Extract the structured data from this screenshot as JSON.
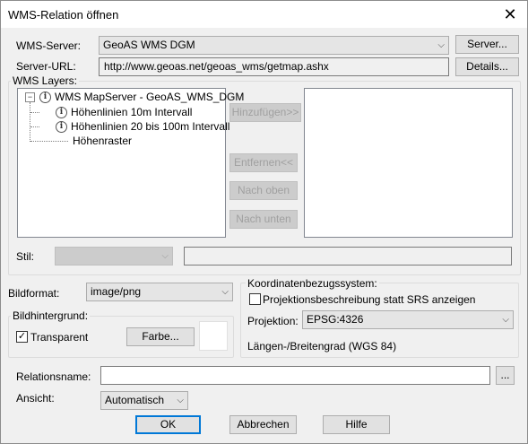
{
  "window": {
    "title": "WMS-Relation öffnen"
  },
  "server": {
    "label": "WMS-Server:",
    "value": "GeoAS WMS DGM",
    "button": "Server..."
  },
  "url": {
    "label": "Server-URL:",
    "value": "http://www.geoas.net/geoas_wms/getmap.ashx",
    "button": "Details..."
  },
  "layers": {
    "label": "WMS Layers:",
    "root": "WMS MapServer - GeoAS_WMS_DGM",
    "items": [
      "Höhenlinien 10m Intervall",
      "Höhenlinien 20 bis 100m Intervall",
      "Höhenraster"
    ],
    "add": "Hinzufügen>>",
    "remove": "Entfernen<<",
    "up": "Nach oben",
    "down": "Nach unten"
  },
  "style": {
    "label": "Stil:"
  },
  "format": {
    "label": "Bildformat:",
    "value": "image/png"
  },
  "background": {
    "label": "Bildhintergrund:",
    "transparent": "Transparent",
    "color_button": "Farbe..."
  },
  "crs": {
    "label": "Koordinatenbezugssystem:",
    "checkbox": "Projektionsbeschreibung statt SRS anzeigen",
    "proj_label": "Projektion:",
    "proj_value": "EPSG:4326",
    "description": "Längen-/Breitengrad (WGS 84)"
  },
  "relation": {
    "label": "Relationsname:",
    "browse": "..."
  },
  "view": {
    "label": "Ansicht:",
    "value": "Automatisch"
  },
  "footer": {
    "ok": "OK",
    "cancel": "Abbrechen",
    "help": "Hilfe"
  }
}
